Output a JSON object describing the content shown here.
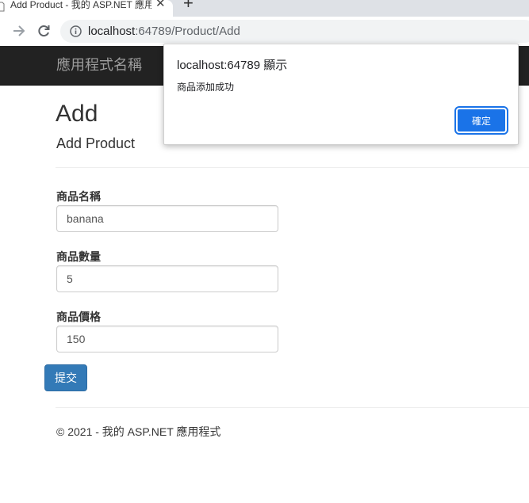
{
  "browser": {
    "tab_title": "Add Product - 我的 ASP.NET 應用程式",
    "tab_close": "✕",
    "new_tab": "+",
    "url_host": "localhost",
    "url_path": ":64789/Product/Add"
  },
  "navbar": {
    "brand": "應用程式名稱"
  },
  "page": {
    "title": "Add",
    "subtitle": "Add Product"
  },
  "form": {
    "fields": [
      {
        "label": "商品名稱",
        "value": "banana"
      },
      {
        "label": "商品數量",
        "value": "5"
      },
      {
        "label": "商品價格",
        "value": "150"
      }
    ],
    "submit_label": "提交"
  },
  "footer": {
    "text": "© 2021 - 我的 ASP.NET 應用程式"
  },
  "dialog": {
    "title": "localhost:64789 顯示",
    "message": "商品添加成功",
    "ok_label": "確定"
  },
  "colors": {
    "navbar_bg": "#222222",
    "primary_button": "#337ab7",
    "dialog_button": "#1a73e8"
  }
}
